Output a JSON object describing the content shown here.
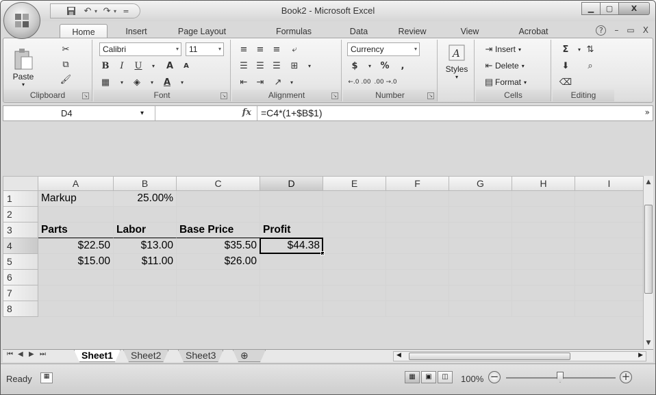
{
  "window": {
    "title": "Book2 - Microsoft Excel",
    "minimize": "▁",
    "maximize": "▢",
    "close": "X"
  },
  "quick_access": {
    "save_icon": "save-icon",
    "undo_icon": "undo-icon",
    "redo_icon": "redo-icon"
  },
  "ribbon_tabs": [
    "Home",
    "Insert",
    "Page Layout",
    "Formulas",
    "Data",
    "Review",
    "View",
    "Acrobat"
  ],
  "active_tab": "Home",
  "ribbon_right": {
    "help": "?",
    "min": "–",
    "restore": "▭",
    "close": "X"
  },
  "groups": {
    "clipboard": {
      "label": "Clipboard",
      "paste": "Paste"
    },
    "font": {
      "label": "Font",
      "font_name": "Calibri",
      "font_size": "11",
      "bold": "B",
      "italic": "I",
      "underline": "U",
      "grow": "A",
      "shrink": "A",
      "font_color": "A"
    },
    "alignment": {
      "label": "Alignment"
    },
    "number": {
      "label": "Number",
      "format": "Currency",
      "currency": "$",
      "percent": "%",
      "comma": ",",
      "inc_dec": "←.0 .00",
      "dec_dec": ".00 →.0"
    },
    "styles": {
      "label": "Styles"
    },
    "cells": {
      "label": "Cells",
      "insert": "Insert",
      "delete": "Delete",
      "format": "Format"
    },
    "editing": {
      "label": "Editing",
      "sum": "Σ"
    }
  },
  "formula_bar": {
    "name_box": "D4",
    "fx": "fx",
    "formula": "=C4*(1+$B$1)",
    "expand": "»"
  },
  "columns": [
    "A",
    "B",
    "C",
    "D",
    "E",
    "F",
    "G",
    "H",
    "I"
  ],
  "selected_column": "D",
  "rows": [
    {
      "n": "1",
      "cells": [
        "Markup",
        "25.00%",
        "",
        "",
        "",
        "",
        "",
        "",
        ""
      ]
    },
    {
      "n": "2",
      "cells": [
        "",
        "",
        "",
        "",
        "",
        "",
        "",
        "",
        ""
      ]
    },
    {
      "n": "3",
      "cells": [
        "Parts",
        "Labor",
        "Base Price",
        "Profit",
        "",
        "",
        "",
        "",
        ""
      ]
    },
    {
      "n": "4",
      "cells": [
        "$22.50",
        "$13.00",
        "$35.50",
        "$44.38",
        "",
        "",
        "",
        "",
        ""
      ]
    },
    {
      "n": "5",
      "cells": [
        "$15.00",
        "$11.00",
        "$26.00",
        "",
        "",
        "",
        "",
        "",
        ""
      ]
    },
    {
      "n": "6",
      "cells": [
        "",
        "",
        "",
        "",
        "",
        "",
        "",
        "",
        ""
      ]
    },
    {
      "n": "7",
      "cells": [
        "",
        "",
        "",
        "",
        "",
        "",
        "",
        "",
        ""
      ]
    },
    {
      "n": "8",
      "cells": [
        "",
        "",
        "",
        "",
        "",
        "",
        "",
        "",
        ""
      ]
    }
  ],
  "selected_row": "4",
  "active_cell": "D4",
  "sheets": [
    "Sheet1",
    "Sheet2",
    "Sheet3"
  ],
  "active_sheet": "Sheet1",
  "status": {
    "ready": "Ready",
    "zoom": "100%",
    "zoom_minus": "−",
    "zoom_plus": "+"
  }
}
